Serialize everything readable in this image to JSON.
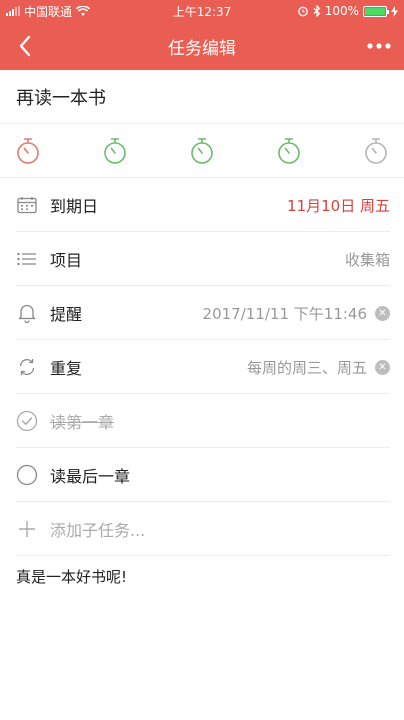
{
  "status_bar": {
    "carrier": "中国联通",
    "time": "上午12:37",
    "battery": "100%"
  },
  "nav": {
    "title": "任务编辑"
  },
  "task": {
    "title": "再读一本书"
  },
  "priority_colors": [
    "#e07a72",
    "#6dbb6a",
    "#6dbb6a",
    "#6dbb6a",
    "#b5b5b5"
  ],
  "rows": {
    "due": {
      "label": "到期日",
      "value": "11月10日 周五"
    },
    "project": {
      "label": "项目",
      "value": "收集箱"
    },
    "reminder": {
      "label": "提醒",
      "value": "2017/11/11 下午11:46"
    },
    "repeat": {
      "label": "重复",
      "value": "每周的周三、周五"
    }
  },
  "subtasks": [
    {
      "label": "读第一章",
      "done": true
    },
    {
      "label": "读最后一章",
      "done": false
    }
  ],
  "add_subtask_placeholder": "添加子任务...",
  "note": "真是一本好书呢!",
  "colors": {
    "accent": "#ea5d52",
    "due_text": "#d6413a"
  }
}
